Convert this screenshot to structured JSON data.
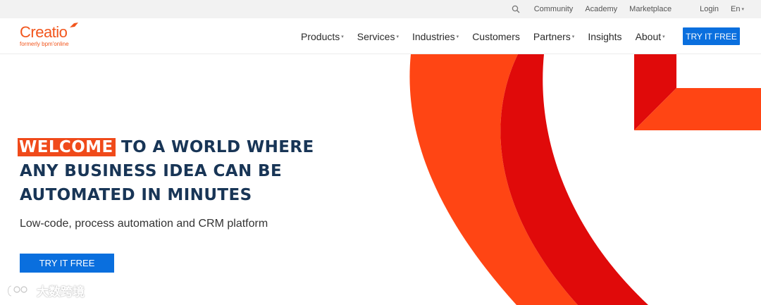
{
  "utility_bar": {
    "community": "Community",
    "academy": "Academy",
    "marketplace": "Marketplace",
    "login": "Login",
    "language": "En"
  },
  "header": {
    "logo_text": "Creatio",
    "logo_subtext": "formerly bpm'online",
    "nav": [
      {
        "label": "Products",
        "has_dropdown": true
      },
      {
        "label": "Services",
        "has_dropdown": true
      },
      {
        "label": "Industries",
        "has_dropdown": true
      },
      {
        "label": "Customers",
        "has_dropdown": false
      },
      {
        "label": "Partners",
        "has_dropdown": true
      },
      {
        "label": "Insights",
        "has_dropdown": false
      },
      {
        "label": "About",
        "has_dropdown": true
      }
    ],
    "cta_label": "TRY IT FREE"
  },
  "hero": {
    "headline_highlight": "WELCOME",
    "headline_line1_rest": "TO A WORLD WHERE",
    "headline_line2": "ANY BUSINESS IDEA CAN BE",
    "headline_line3": "AUTOMATED IN MINUTES",
    "subline": "Low-code, process automation and CRM platform",
    "cta_label": "TRY IT FREE"
  },
  "watermark": {
    "text": "大数跨境"
  },
  "colors": {
    "brand_orange": "#f2561d",
    "highlight_orange": "#f04a1a",
    "deco_red": "#e00a0a",
    "deco_orange": "#ff4514",
    "cta_blue": "#0a6fde",
    "headline_navy": "#183556"
  },
  "icons": {
    "search": "search-icon",
    "dropdown": "chevron-down-icon"
  }
}
